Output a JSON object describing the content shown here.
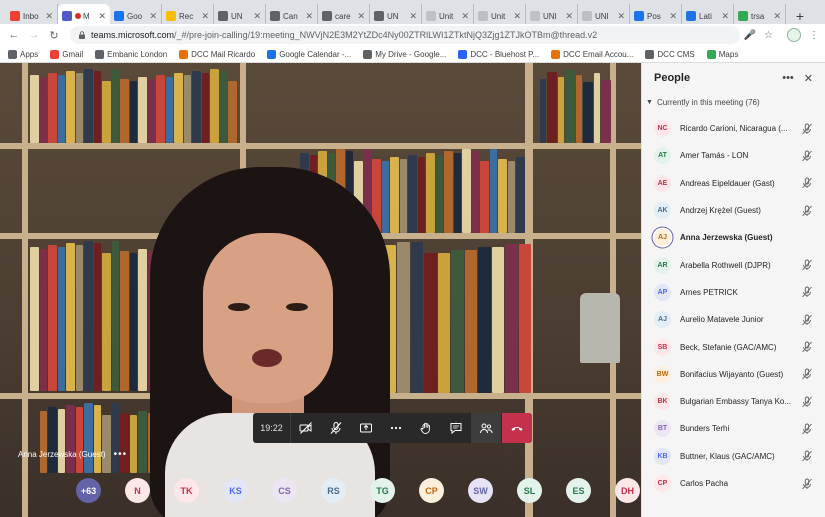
{
  "browser": {
    "tabs": [
      {
        "label": "Inbo",
        "icon": "gmail-icon",
        "color": "#ea4335"
      },
      {
        "label": "M",
        "icon": "teams-icon",
        "color": "#5059c9",
        "active": true,
        "recording": true
      },
      {
        "label": "Goo",
        "icon": "google-sheets-icon",
        "color": "#1a73e8"
      },
      {
        "label": "Rec",
        "icon": "google-drive-icon",
        "color": "#fbbc04"
      },
      {
        "label": "UN",
        "icon": "web-icon",
        "color": "#5f6368"
      },
      {
        "label": "Can",
        "icon": "web-icon",
        "color": "#5f6368"
      },
      {
        "label": "care",
        "icon": "web-icon",
        "color": "#5f6368"
      },
      {
        "label": "UN",
        "icon": "web-icon",
        "color": "#5f6368"
      },
      {
        "label": "Unit",
        "icon": "cloud-icon",
        "color": "#bdc1c6"
      },
      {
        "label": "Unit",
        "icon": "cloud-icon",
        "color": "#bdc1c6"
      },
      {
        "label": "UNI",
        "icon": "cloud-icon",
        "color": "#bdc1c6"
      },
      {
        "label": "UNI",
        "icon": "cloud-icon",
        "color": "#bdc1c6"
      },
      {
        "label": "Pos",
        "icon": "web-icon",
        "color": "#1a73e8"
      },
      {
        "label": "Lati",
        "icon": "web-icon",
        "color": "#1a73e8"
      },
      {
        "label": "trsa",
        "icon": "google-icon",
        "color": "#34a853"
      }
    ],
    "url_host": "teams.microsoft.com",
    "url_path": "/_#/pre-join-calling/19:meeting_NWVjN2E3M2YtZDc4Ny00ZTRlLWI1ZTktNjQ3Zjg1ZTJkOTBm@thread.v2",
    "bookmarks": [
      {
        "label": "Apps",
        "icon": "apps-grid-icon",
        "color": "#5f6368"
      },
      {
        "label": "Gmail",
        "icon": "gmail-icon",
        "color": "#ea4335"
      },
      {
        "label": "Embanic London",
        "icon": "web-icon",
        "color": "#5f6368"
      },
      {
        "label": "DCC Mail Ricardo",
        "icon": "dcc-icon",
        "color": "#e8710a"
      },
      {
        "label": "Google Calendar -...",
        "icon": "calendar-icon",
        "color": "#1a73e8"
      },
      {
        "label": "My Drive - Google...",
        "icon": "web-icon",
        "color": "#5f6368"
      },
      {
        "label": "DCC - Bluehost P...",
        "icon": "bluehost-icon",
        "color": "#2962ff"
      },
      {
        "label": "DCC Email Accou...",
        "icon": "dcc-icon",
        "color": "#e8710a"
      },
      {
        "label": "DCC CMS",
        "icon": "web-icon",
        "color": "#5f6368"
      },
      {
        "label": "Maps",
        "icon": "maps-icon",
        "color": "#34a853"
      }
    ]
  },
  "meeting": {
    "speaker_name": "Anna Jerzewska (Guest)",
    "timer": "19:22",
    "avatar_strip": [
      {
        "initials": "+63",
        "bg": "#6264a7",
        "fg": "#ffffff"
      },
      {
        "initials": "N",
        "bg": "#fde7e9",
        "fg": "#c4314b"
      },
      {
        "initials": "TK",
        "bg": "#fde7e9",
        "fg": "#c4314b"
      },
      {
        "initials": "KS",
        "bg": "#e2e6f5",
        "fg": "#4f6bed"
      },
      {
        "initials": "CS",
        "bg": "#ece5f3",
        "fg": "#8764b8"
      },
      {
        "initials": "RS",
        "bg": "#e3edf5",
        "fg": "#4a6c8c"
      },
      {
        "initials": "TG",
        "bg": "#e3f2ea",
        "fg": "#237b4b"
      },
      {
        "initials": "CP",
        "bg": "#fcefdc",
        "fg": "#c0670a"
      },
      {
        "initials": "SW",
        "bg": "#e6e4f4",
        "fg": "#6264a7"
      },
      {
        "initials": "SL",
        "bg": "#e3f2ea",
        "fg": "#237b4b"
      },
      {
        "initials": "ES",
        "bg": "#e3f2ea",
        "fg": "#237b4b"
      },
      {
        "initials": "DH",
        "bg": "#fde7e9",
        "fg": "#c4314b"
      }
    ]
  },
  "people_panel": {
    "title": "People",
    "section_label": "Currently in this meeting (76)",
    "participants": [
      {
        "initials": "NC",
        "name": "Ricardo Carioni, Nicaragua (...",
        "bg": "#fde7e9",
        "fg": "#c4314b"
      },
      {
        "initials": "AT",
        "name": "Amer Tamás - LON",
        "bg": "#e3f2ea",
        "fg": "#237b4b"
      },
      {
        "initials": "AE",
        "name": "Andreas Eipeldauer (Gast)",
        "bg": "#fde7e9",
        "fg": "#c4314b"
      },
      {
        "initials": "AK",
        "name": "Andrzej Krężel (Guest)",
        "bg": "#e3edf5",
        "fg": "#4a6c8c"
      },
      {
        "initials": "AJ",
        "name": "Anna Jerzewska (Guest)",
        "bg": "#fcefdc",
        "fg": "#c0670a",
        "speaking": true
      },
      {
        "initials": "AR",
        "name": "Arabella Rothwell (DJPR)",
        "bg": "#e3f2ea",
        "fg": "#237b4b"
      },
      {
        "initials": "AP",
        "name": "Arnes PETRICK",
        "bg": "#e2e6f5",
        "fg": "#4f6bed"
      },
      {
        "initials": "AJ",
        "name": "Aurelio Matavele Junior",
        "bg": "#e3edf5",
        "fg": "#4a6c8c"
      },
      {
        "initials": "SB",
        "name": "Beck, Stefanie (GAC/AMC)",
        "bg": "#fde7e9",
        "fg": "#c4314b"
      },
      {
        "initials": "BW",
        "name": "Bonifacius Wijayanto (Guest)",
        "bg": "#fcefdc",
        "fg": "#c0670a"
      },
      {
        "initials": "BK",
        "name": "Bulgarian Embassy Tanya Ko...",
        "bg": "#fde7e9",
        "fg": "#c4314b"
      },
      {
        "initials": "BT",
        "name": "Bunders Terhi",
        "bg": "#ece5f3",
        "fg": "#8764b8"
      },
      {
        "initials": "KB",
        "name": "Buttner, Klaus (GAC/AMC)",
        "bg": "#e2e6f5",
        "fg": "#4f6bed"
      },
      {
        "initials": "CP",
        "name": "Carlos Pacha",
        "bg": "#fde7e9",
        "fg": "#c4314b"
      }
    ]
  }
}
